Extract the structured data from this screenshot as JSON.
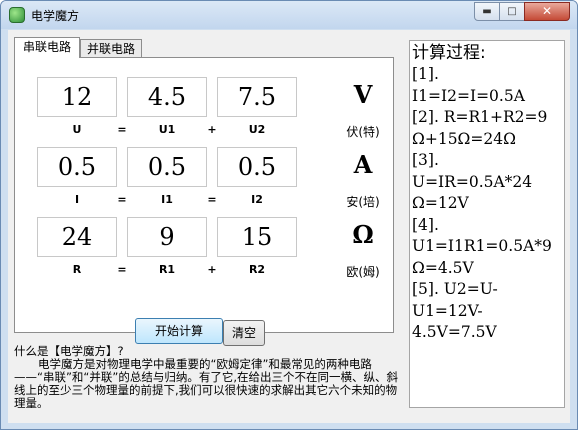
{
  "window": {
    "title": "电学魔方",
    "close_glyph": "✕",
    "min_glyph": "▬",
    "max_glyph": "□"
  },
  "tabs": [
    {
      "label": "串联电路"
    },
    {
      "label": "并联电路"
    }
  ],
  "rows": [
    {
      "values": [
        "12",
        "4.5",
        "7.5"
      ],
      "labels": [
        "U",
        "U1",
        "U2"
      ],
      "ops": [
        "=",
        "+"
      ],
      "unit_symbol": "V",
      "unit_name": "伏(特)"
    },
    {
      "values": [
        "0.5",
        "0.5",
        "0.5"
      ],
      "labels": [
        "I",
        "I1",
        "I2"
      ],
      "ops": [
        "=",
        "="
      ],
      "unit_symbol": "A",
      "unit_name": "安(培)"
    },
    {
      "values": [
        "24",
        "9",
        "15"
      ],
      "labels": [
        "R",
        "R1",
        "R2"
      ],
      "ops": [
        "=",
        "+"
      ],
      "unit_symbol": "Ω",
      "unit_name": "欧(姆)"
    }
  ],
  "buttons": {
    "calculate": "开始计算",
    "clear": "清空"
  },
  "info": {
    "question": "什么是【电学魔方】?",
    "description": "电学魔方是对物理电学中最重要的“欧姆定律”和最常见的两种电路——“串联”和“并联”的总结与归纳。有了它,在给出三个不在同一横、纵、斜线上的至少三个物理量的前提下,我们可以很快速的求解出其它六个未知的物理量。"
  },
  "process": {
    "title": "计算过程:",
    "body": "[1].\nI1=I2=I=0.5A\n[2]. R=R1+R2=9\nΩ+15Ω=24Ω\n[3].\nU=IR=0.5A*24\nΩ=12V\n[4].\nU1=I1R1=0.5A*9\nΩ=4.5V\n[5]. U2=U-\nU1=12V-\n4.5V=7.5V"
  }
}
